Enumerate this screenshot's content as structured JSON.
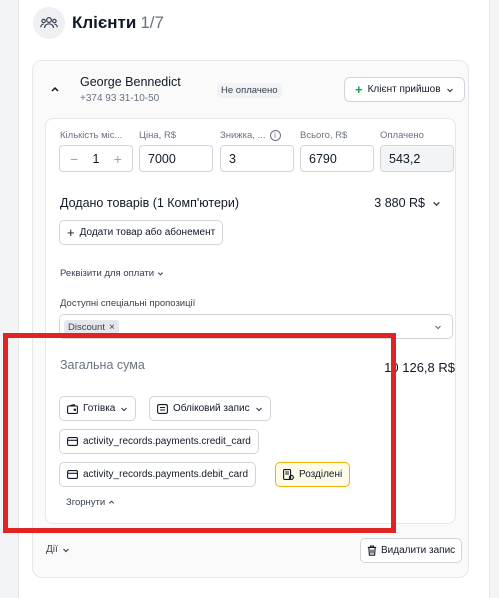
{
  "header": {
    "title": "Клієнти",
    "count": "1/7"
  },
  "client": {
    "name": "George Bennedict",
    "phone": "+374 93 31-10-50",
    "status_badge": "Не оплачено",
    "arrived_button": "Клієнт прийшов"
  },
  "fields": {
    "quantity": {
      "label": "Кількість міс...",
      "value": "1"
    },
    "price": {
      "label": "Ціна, R$",
      "value": "7000"
    },
    "discount": {
      "label": "Знижка, ...",
      "value": "3"
    },
    "total": {
      "label": "Всього, R$",
      "value": "6790"
    },
    "paid": {
      "label": "Оплачено",
      "value": "543,2"
    }
  },
  "goods": {
    "title": "Додано товарів (1 Комп'ютери)",
    "sum": "3 880 R$",
    "add_button": "Додати товар або абонемент"
  },
  "requisites_link": "Реквізити для оплати",
  "offers": {
    "label": "Доступні спеціальні пропозиції",
    "chip": "Discount"
  },
  "total_sum": {
    "label": "Загальна сума",
    "value": "10 126,8 R$"
  },
  "payment": {
    "cash": "Готівка",
    "account": "Обліковий запис",
    "credit_card": "activity_records.payments.credit_card",
    "debit_card": "activity_records.payments.debit_card",
    "split": "Розділені"
  },
  "collapse_link": "Згорнути",
  "footer": {
    "actions": "Дії",
    "delete_button": "Видалити запис"
  },
  "colors": {
    "highlight": "#e02424",
    "accent_green": "#16a34a",
    "split_border": "#eab308"
  }
}
